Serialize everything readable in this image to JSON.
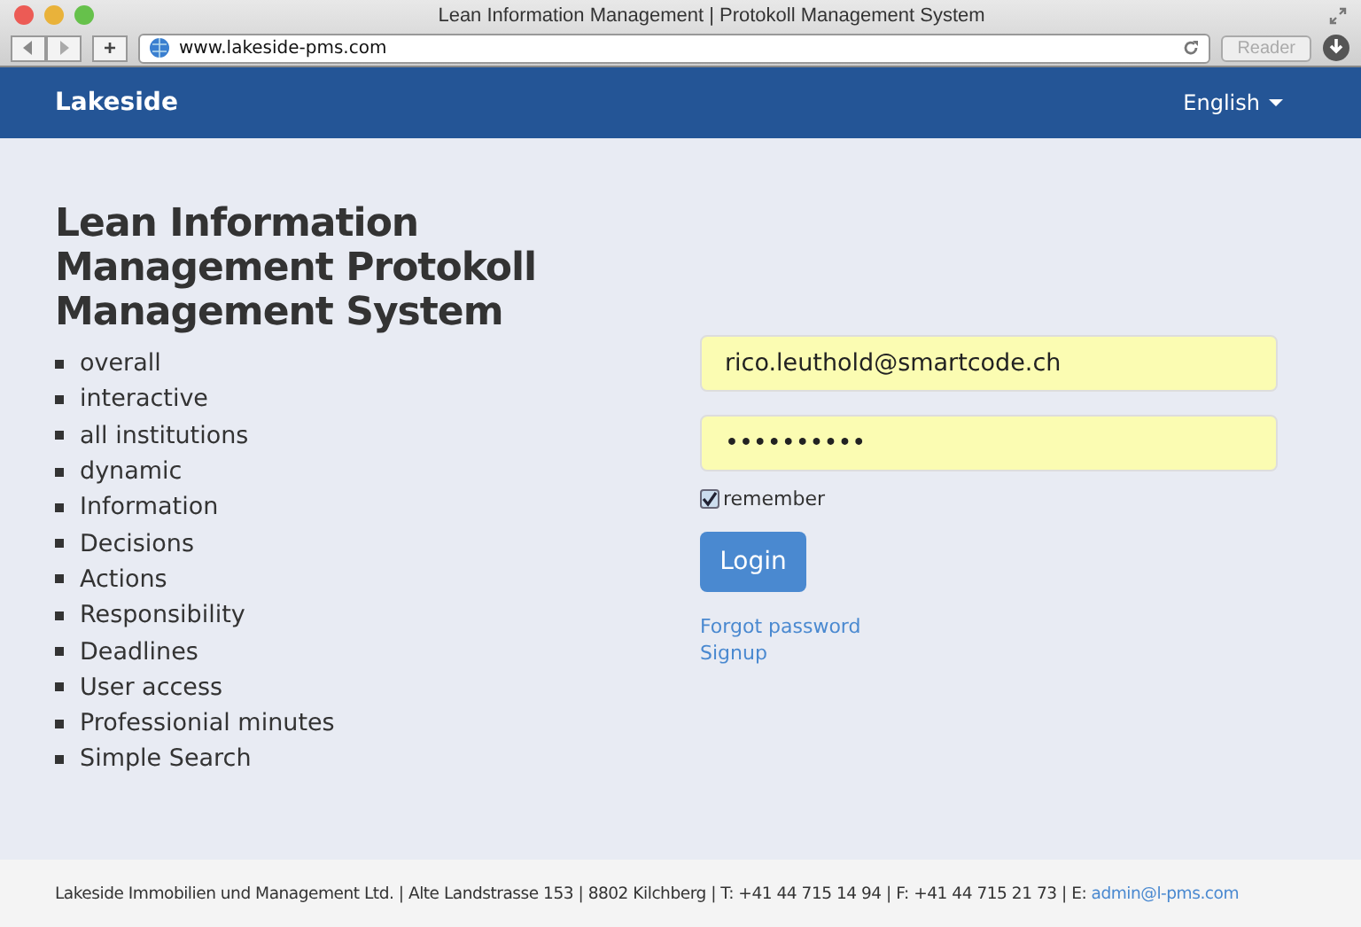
{
  "browser": {
    "title": "Lean Information Management | Protokoll Management System",
    "url": "www.lakeside-pms.com",
    "add_tab": "+",
    "reader": {
      "label": "Reader",
      "disabled": true
    }
  },
  "navbar": {
    "brand": "Lakeside",
    "language": "English"
  },
  "heading": "Lean Information Management Protokoll Management System",
  "features": [
    "overall",
    "interactive",
    "all institutions",
    "dynamic",
    "Information",
    "Decisions",
    "Actions",
    "Responsibility",
    "Deadlines",
    "User access",
    "Professionial minutes",
    "Simple Search"
  ],
  "login": {
    "email": "rico.leuthold@smartcode.ch",
    "password": "••••••••••",
    "remember": {
      "label": "remember",
      "checked": true
    },
    "button": "Login",
    "links": [
      "Forgot password",
      "Signup"
    ]
  },
  "footer": {
    "text": "Lakeside Immobilien und Management Ltd. | Alte Landstrasse 153 | 8802 Kilchberg | T: +41 44 715 14 94 | F: +41 44 715 21 73 | E: ",
    "email": "admin@l-pms.com"
  }
}
